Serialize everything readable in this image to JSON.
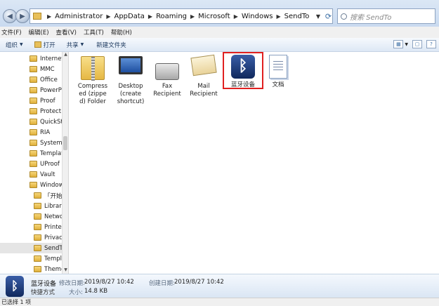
{
  "address": {
    "segments": [
      "Administrator",
      "AppData",
      "Roaming",
      "Microsoft",
      "Windows",
      "SendTo"
    ]
  },
  "search": {
    "placeholder": "搜索 SendTo"
  },
  "menu": [
    "文件(F)",
    "编辑(E)",
    "查看(V)",
    "工具(T)",
    "帮助(H)"
  ],
  "toolbar": {
    "organize": "组织",
    "open": "打开",
    "share": "共享",
    "new_folder": "新建文件夹"
  },
  "nav_tree": [
    {
      "label": "Internet",
      "indent": 0
    },
    {
      "label": "MMC",
      "indent": 0
    },
    {
      "label": "Office",
      "indent": 0
    },
    {
      "label": "PowerPo",
      "indent": 0
    },
    {
      "label": "Proof",
      "indent": 0
    },
    {
      "label": "Protect",
      "indent": 0
    },
    {
      "label": "QuickSty",
      "indent": 0
    },
    {
      "label": "RIA",
      "indent": 0
    },
    {
      "label": "SystemC",
      "indent": 0
    },
    {
      "label": "Templat",
      "indent": 0
    },
    {
      "label": "UProof",
      "indent": 0
    },
    {
      "label": "Vault",
      "indent": 0
    },
    {
      "label": "Window",
      "indent": 0
    },
    {
      "label": "「开始」",
      "indent": 1
    },
    {
      "label": "Librarie",
      "indent": 1
    },
    {
      "label": "Netwo",
      "indent": 1
    },
    {
      "label": "Printer",
      "indent": 1
    },
    {
      "label": "PrivacI",
      "indent": 1
    },
    {
      "label": "SendTo",
      "indent": 1,
      "selected": true
    },
    {
      "label": "Templ",
      "indent": 1
    },
    {
      "label": "Theme",
      "indent": 1
    }
  ],
  "files": [
    {
      "label": "Compressed (zipped) Folder",
      "icon": "zip-folder-icon"
    },
    {
      "label": "Desktop (create shortcut)",
      "icon": "desktop-icon"
    },
    {
      "label": "Fax Recipient",
      "icon": "fax-icon"
    },
    {
      "label": "Mail Recipient",
      "icon": "mail-icon"
    },
    {
      "label": "蓝牙设备",
      "icon": "bluetooth-icon",
      "selected": true
    },
    {
      "label": "文档",
      "icon": "document-icon"
    }
  ],
  "details": {
    "name": "蓝牙设备",
    "type": "快捷方式",
    "modified_label": "修改日期:",
    "modified_value": "2019/8/27 10:42",
    "created_label": "创建日期:",
    "created_value": "2019/8/27 10:42",
    "size_label": "大小:",
    "size_value": "14.8 KB"
  },
  "status": "已选择 1 项",
  "colors": {
    "selection_outline": "#e02020",
    "bluetooth_bg": "#1a3a7a"
  }
}
